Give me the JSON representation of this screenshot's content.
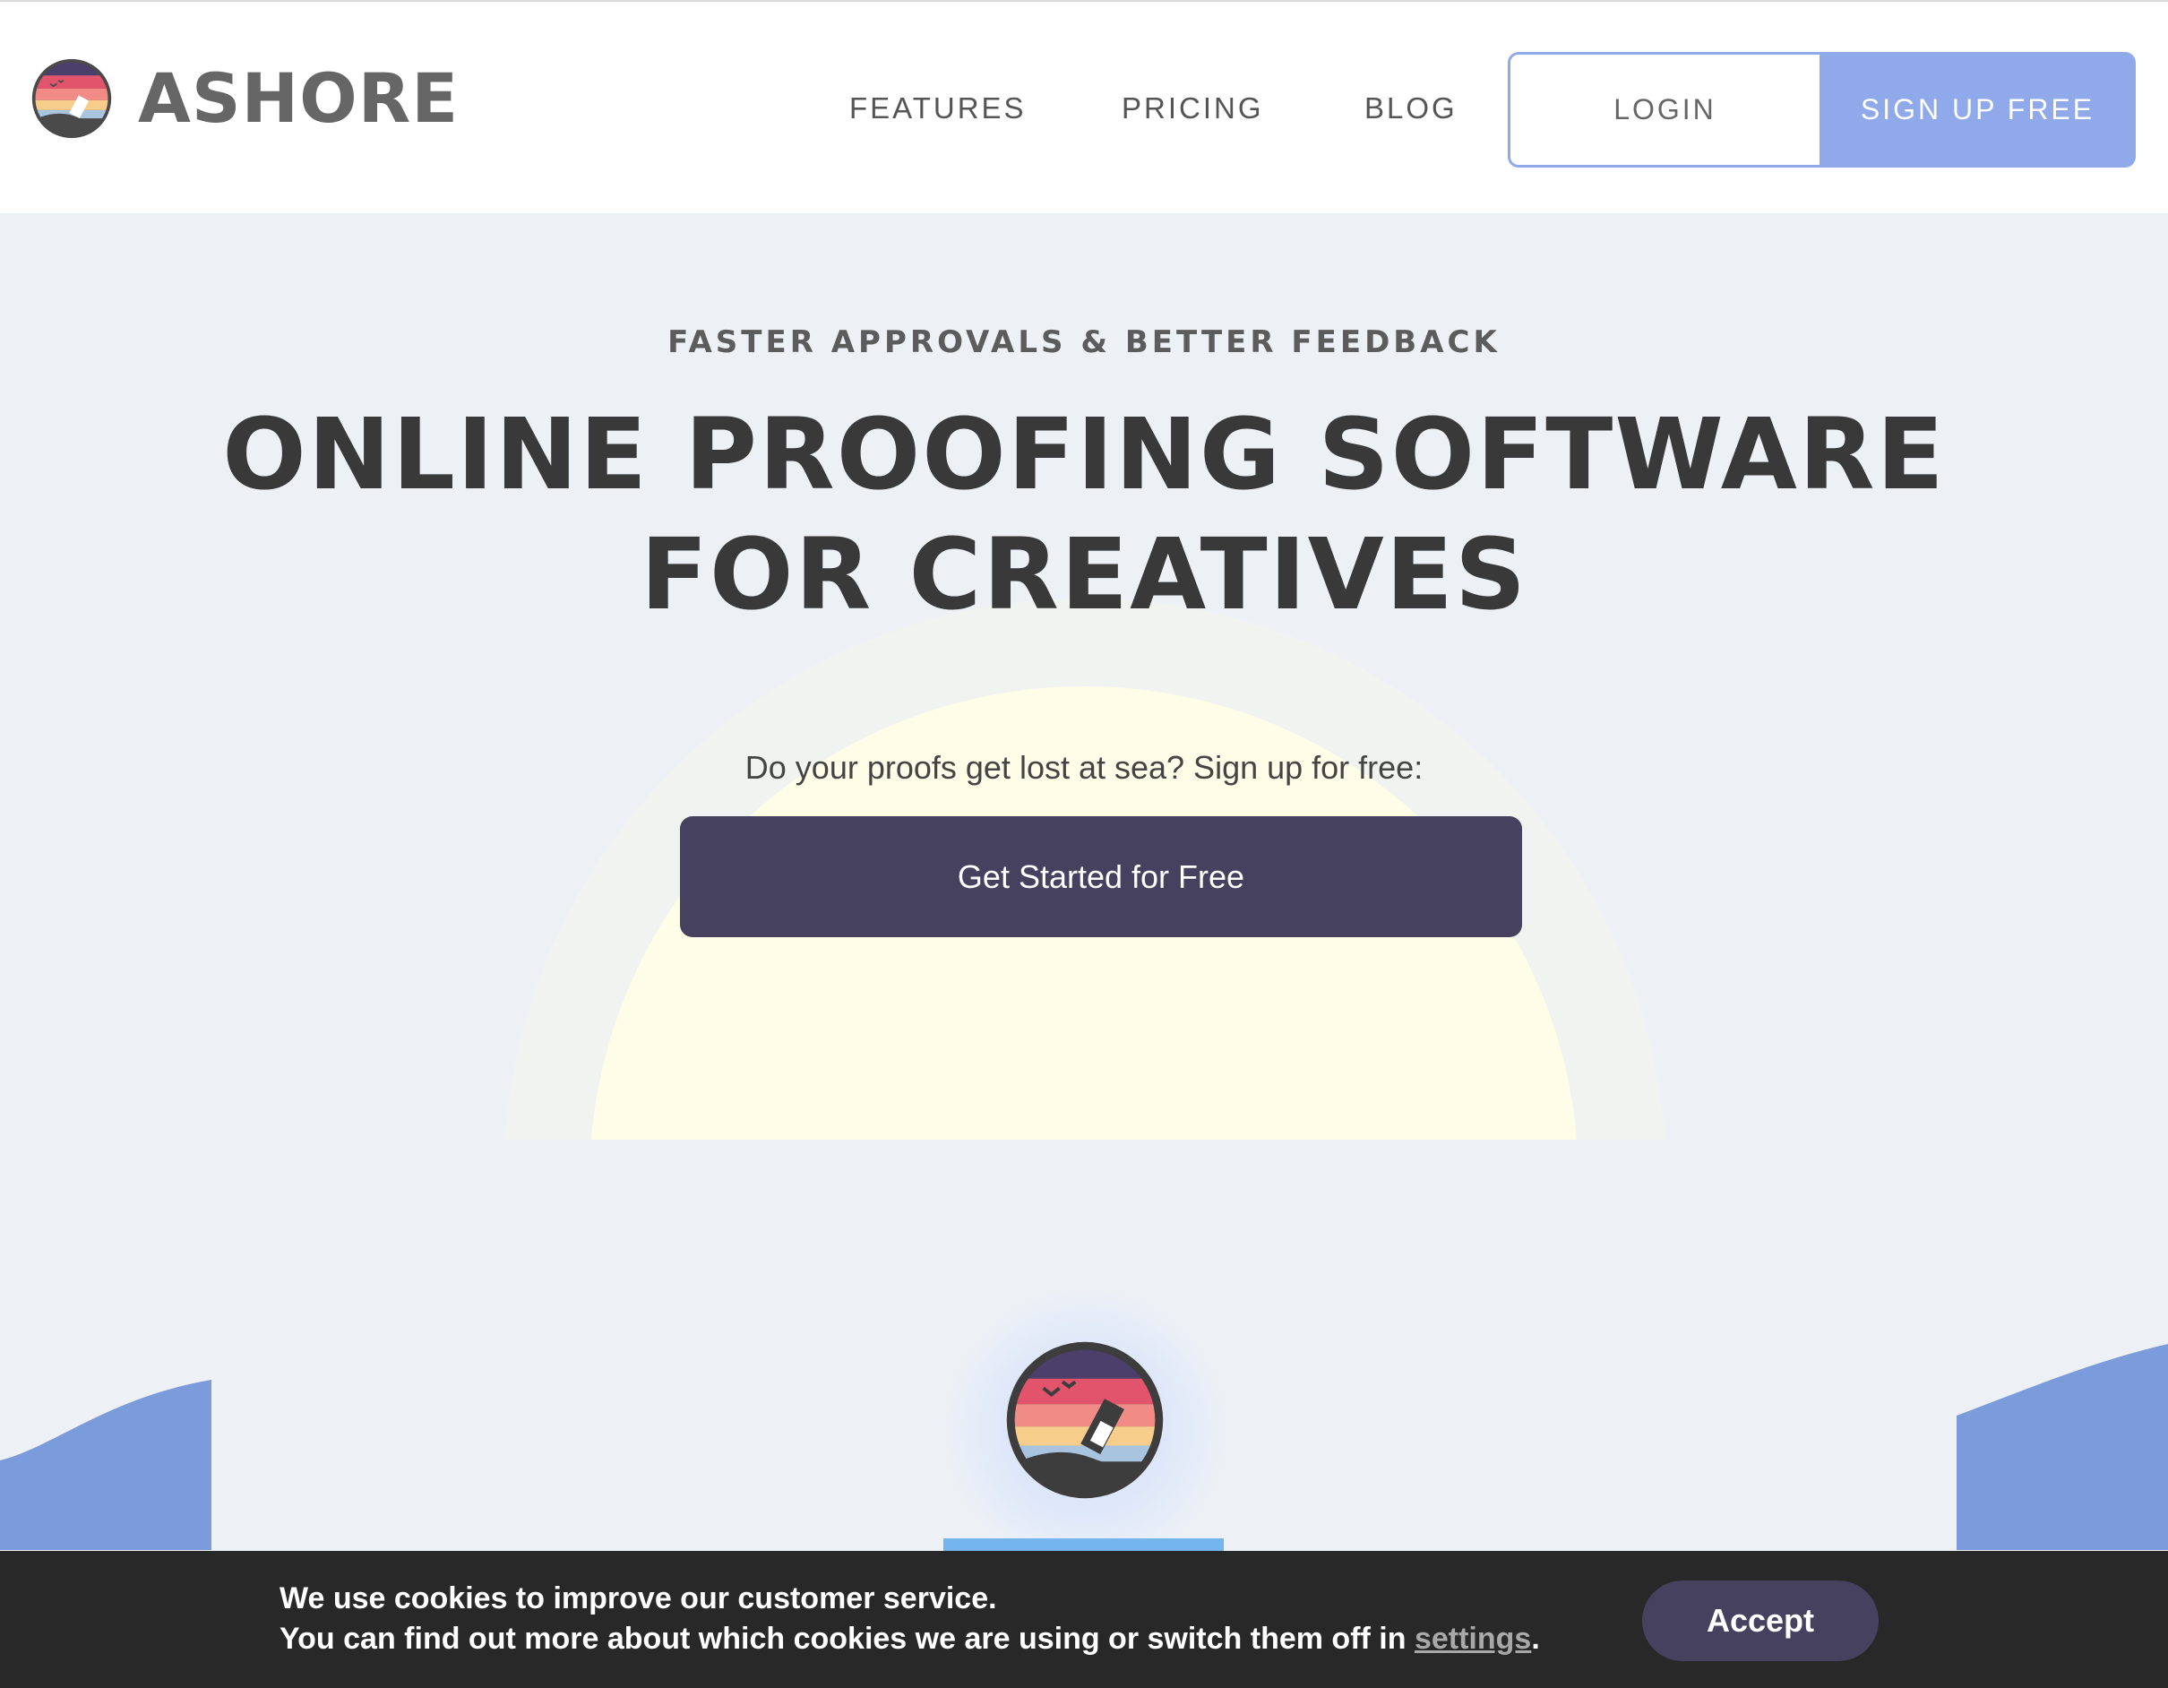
{
  "header": {
    "brand": "ASHORE",
    "nav": {
      "features": "FEATURES",
      "pricing": "PRICING",
      "blog": "BLOG"
    },
    "login_label": "LOGIN",
    "signup_label": "SIGN UP FREE"
  },
  "hero": {
    "tagline": "FASTER APPROVALS & BETTER FEEDBACK",
    "headline_line1": "ONLINE PROOFING SOFTWARE",
    "headline_line2": "FOR CREATIVES",
    "subtext": "Do your proofs get lost at sea? Sign up for free:",
    "cta_label": "Get Started for Free"
  },
  "cookie_banner": {
    "line1": "We use cookies to improve our customer service.",
    "line2_prefix": "You can find out more about which cookies we are using or switch them off in ",
    "link_text": "settings",
    "line2_suffix": ".",
    "accept_label": "Accept"
  },
  "colors": {
    "accent": "#8fa9ea",
    "cta": "#46415e",
    "wave": "#7b9bdb",
    "banner": "#282828"
  },
  "icons": [
    "ashore-logo-icon",
    "message-in-bottle-badge-icon"
  ]
}
